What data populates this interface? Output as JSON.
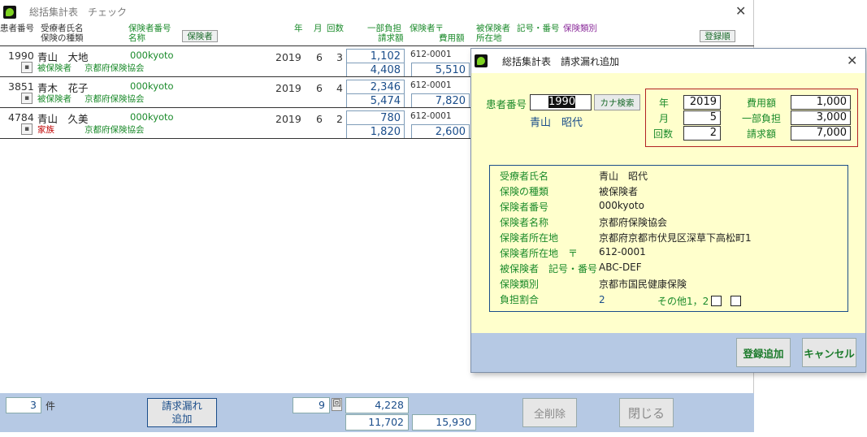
{
  "main": {
    "title": "総括集計表　チェック",
    "headers": {
      "patient_no": "患者番号",
      "patient_name": "受療者氏名",
      "insurance_type": "保険の種類",
      "insurer_no": "保険者番号",
      "insurer_name": "名称",
      "insurer_button": "保険者",
      "year": "年",
      "month": "月",
      "count": "回数",
      "copay": "一部負担",
      "claim": "請求額",
      "insurer_zip": "保険者〒",
      "location": "所在地",
      "cost": "費用額",
      "insured": "被保険者",
      "symbol_no": "記号・番号",
      "insurance_class": "保険類別",
      "sort_button": "登録順"
    },
    "rows": [
      {
        "id": "1990",
        "name": "青山　大地",
        "insurer_no": "000kyoto",
        "year": "2019",
        "month": "6",
        "count": "3",
        "copay": "1,102",
        "claim": "4,408",
        "zip": "612-0001",
        "cost": "5,510",
        "type": "被保険者",
        "insurer_name": "京都府保険協会",
        "type_color": "#1a8a2a"
      },
      {
        "id": "3851",
        "name": "青木　花子",
        "insurer_no": "000kyoto",
        "year": "2019",
        "month": "6",
        "count": "4",
        "copay": "2,346",
        "claim": "5,474",
        "zip": "612-0001",
        "cost": "7,820",
        "type": "被保険者",
        "insurer_name": "京都府保険協会",
        "type_color": "#1a8a2a"
      },
      {
        "id": "4784",
        "name": "青山　久美",
        "insurer_no": "000kyoto",
        "year": "2019",
        "month": "6",
        "count": "2",
        "copay": "780",
        "claim": "1,820",
        "zip": "612-0001",
        "cost": "2,600",
        "type": "家族",
        "insurer_name": "京都府保険協会",
        "type_color": "#c00000"
      }
    ],
    "footer": {
      "record_count": "3",
      "record_unit": "件",
      "add_missing_line1": "請求漏れ",
      "add_missing_line2": "追加",
      "total_count": "9",
      "count_unit": "回",
      "total_copay": "4,228",
      "total_claim": "11,702",
      "total_cost": "15,930",
      "delete_all": "全削除",
      "close": "閉じる"
    }
  },
  "dialog": {
    "title": "総括集計表　請求漏れ追加",
    "patient_no_label": "患者番号",
    "patient_no_value": "1990",
    "kana_search": "カナ検索",
    "patient_name": "青山　昭代",
    "year_label": "年",
    "year_value": "2019",
    "month_label": "月",
    "month_value": "5",
    "count_label": "回数",
    "count_value": "2",
    "cost_label": "費用額",
    "cost_value": "1,000",
    "copay_label": "一部負担",
    "copay_value": "3,000",
    "claim_label": "請求額",
    "claim_value": "7,000",
    "info": [
      {
        "label": "受療者氏名",
        "value": "青山　昭代"
      },
      {
        "label": "保険の種類",
        "value": "被保険者"
      },
      {
        "label": "保険者番号",
        "value": "000kyoto"
      },
      {
        "label": "保険者名称",
        "value": "京都府保険協会"
      },
      {
        "label": "保険者所在地",
        "value": "京都府京都市伏見区深草下高松町1"
      },
      {
        "label": "保険者所在地　〒",
        "value": "612-0001"
      },
      {
        "label": "被保険者　記号・番号",
        "value": "ABC-DEF"
      },
      {
        "label": "保険類別",
        "value": "京都市国民健康保険"
      }
    ],
    "burden_label": "負担割合",
    "burden_value": "2",
    "other_label": "その他1，2",
    "register_button": "登録追加",
    "cancel_button": "キャンセル"
  },
  "colors": {
    "accent_green": "#1a8a2a",
    "footer_blue": "#b6c9e4",
    "dialog_bg": "#ffffcc",
    "value_blue": "#1a4d8a"
  }
}
